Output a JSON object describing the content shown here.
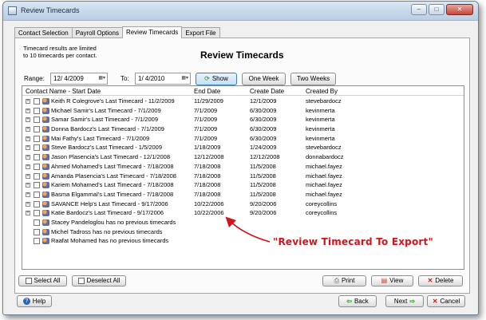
{
  "window": {
    "title": "Review Timecards",
    "buttons": {
      "minimize": "–",
      "maximize": "□",
      "close": "✕"
    }
  },
  "tabs": [
    "Contact Selection",
    "Payroll Options",
    "Review Timecards",
    "Export File"
  ],
  "active_tab": "Review Timecards",
  "info_text_1": "Timecard results are limited",
  "info_text_2": "to 10 timecards per contact.",
  "heading": "Review Timecards",
  "filter": {
    "range_label": "Range:",
    "from_date": "12/ 4/2009",
    "to_label": "To:",
    "to_date": "1/ 4/2010",
    "show_button": "Show",
    "one_week_button": "One Week",
    "two_weeks_button": "Two Weeks"
  },
  "columns": [
    "Contact Name - Start Date",
    "End Date",
    "Create Date",
    "Created By"
  ],
  "rows": [
    {
      "name": "Keith R Colegrove's Last Timecard  - 11/2/2009",
      "end": "11/29/2009",
      "created": "12/1/2009",
      "by": "stevebardocz",
      "expandable": true
    },
    {
      "name": "Michael Samir's Last Timecard  - 7/1/2009",
      "end": "7/1/2009",
      "created": "6/30/2009",
      "by": "kevinmerta",
      "expandable": true
    },
    {
      "name": "Samar Samir's Last Timecard  - 7/1/2009",
      "end": "7/1/2009",
      "created": "6/30/2009",
      "by": "kevinmerta",
      "expandable": true
    },
    {
      "name": "Donna Bardocz's Last Timecard  - 7/1/2009",
      "end": "7/1/2009",
      "created": "6/30/2009",
      "by": "kevinmerta",
      "expandable": true
    },
    {
      "name": "Mai Fathy's Last Timecard  - 7/1/2009",
      "end": "7/1/2009",
      "created": "6/30/2009",
      "by": "kevinmerta",
      "expandable": true
    },
    {
      "name": "Steve Bardocz's Last Timecard  - 1/5/2009",
      "end": "1/18/2009",
      "created": "1/24/2009",
      "by": "stevebardocz",
      "expandable": true
    },
    {
      "name": "Jason Plasencia's Last Timecard  - 12/1/2008",
      "end": "12/12/2008",
      "created": "12/12/2008",
      "by": "donnabardocz",
      "expandable": true
    },
    {
      "name": "Ahmed Mohamed's Last Timecard  - 7/18/2008",
      "end": "7/18/2008",
      "created": "11/5/2008",
      "by": "michael.fayez",
      "expandable": true
    },
    {
      "name": "Amanda Plasencia's Last Timecard  - 7/18/2008",
      "end": "7/18/2008",
      "created": "11/5/2008",
      "by": "michael.fayez",
      "expandable": true
    },
    {
      "name": "Kariem Mohamed's Last Timecard  - 7/18/2008",
      "end": "7/18/2008",
      "created": "11/5/2008",
      "by": "michael.fayez",
      "expandable": true
    },
    {
      "name": "Basma Elgammal's Last Timecard  - 7/18/2008",
      "end": "7/18/2008",
      "created": "11/5/2008",
      "by": "michael.fayez",
      "expandable": true
    },
    {
      "name": "SAVANCE Help's Last Timecard  - 9/17/2006",
      "end": "10/22/2006",
      "created": "9/20/2006",
      "by": "coreycollins",
      "expandable": true
    },
    {
      "name": "Katie Bardocz's Last Timecard  - 9/17/2006",
      "end": "10/22/2006",
      "created": "9/20/2006",
      "by": "coreycollins",
      "expandable": true
    },
    {
      "name": "Stacey Pandeloglou has no previous timecards",
      "end": "",
      "created": "",
      "by": "",
      "expandable": false
    },
    {
      "name": "Michel Tadross has no previous timecards",
      "end": "",
      "created": "",
      "by": "",
      "expandable": false
    },
    {
      "name": "Raafat Mohamed has no previous timecards",
      "end": "",
      "created": "",
      "by": "",
      "expandable": false
    }
  ],
  "annotation": "\"Review Timecard To Export\"",
  "actions": {
    "select_all": "Select All",
    "deselect_all": "Deselect All",
    "print": "Print",
    "view": "View",
    "delete": "Delete"
  },
  "footer": {
    "help": "Help",
    "back": "Back",
    "next": "Next",
    "cancel": "Cancel"
  },
  "colors": {
    "annotation": "#d3141c",
    "accent": "#3c7fb1"
  }
}
